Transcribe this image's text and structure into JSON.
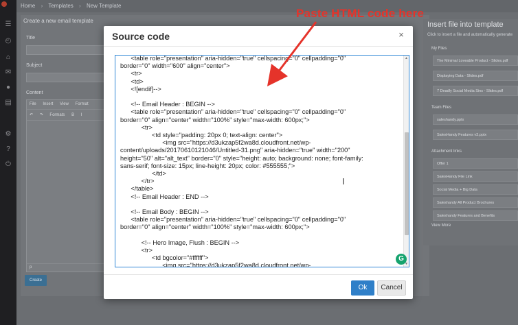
{
  "background": {
    "breadcrumb": [
      "Home",
      "Templates",
      "New Template"
    ],
    "card_title": "Create a new email template",
    "fields": {
      "title_label": "Title",
      "subject_label": "Subject",
      "content_label": "Content"
    },
    "editor": {
      "menus": [
        "File",
        "Insert",
        "View",
        "Format"
      ],
      "toolbar": [
        "↶",
        "↷",
        "Formats",
        "B",
        "I"
      ],
      "status_path": "p"
    },
    "create_button": "Create",
    "right_panel": {
      "title": "Insert file into template",
      "subtitle": "Click to insert a file and automatically generate",
      "sections": {
        "my_files": "My Files",
        "team_files": "Team Files",
        "attachment_links": "Attachment links"
      },
      "my_files": [
        "The Minimal Loveable Product - Slides.pdf",
        "Displaying Data - Slides.pdf",
        "7 Deadly Social Media Sins - Slides.pdf"
      ],
      "team_files": [
        "saleshandy.pptx",
        "SalesHandy Features v3.pptx"
      ],
      "attachment_links": [
        "Offer 1",
        "SalesHandy File Link",
        "Social Media + Big Data",
        "Saleshandy All Product Brochures",
        "Saleshandy Features and Benefits"
      ],
      "view_more": "View More"
    }
  },
  "modal": {
    "title": "Source code",
    "close_glyph": "×",
    "code": "      <table role=\"presentation\" aria-hidden=\"true\" cellspacing=\"0\" cellpadding=\"0\"\nborder=\"0\" width=\"600\" align=\"center\">\n      <tr>\n      <td>\n      <![endif]-->\n\n      <!-- Email Header : BEGIN -->\n      <table role=\"presentation\" aria-hidden=\"true\" cellspacing=\"0\" cellpadding=\"0\"\nborder=\"0\" align=\"center\" width=\"100%\" style=\"max-width: 600px;\">\n            <tr>\n                  <td style=\"padding: 20px 0; text-align: center\">\n                        <img src=\"https://d3ukzap5f2wa8d.cloudfront.net/wp-\ncontent/uploads/20170610121046/Untitled-31.png\" aria-hidden=\"true\" width=\"200\"\nheight=\"50\" alt=\"alt_text\" border=\"0\" style=\"height: auto; background: none; font-family:\nsans-serif; font-size: 15px; line-height: 20px; color: #555555;\">\n                  </td>\n            </tr>\n      </table>\n      <!-- Email Header : END -->\n\n      <!-- Email Body : BEGIN -->\n      <table role=\"presentation\" aria-hidden=\"true\" cellspacing=\"0\" cellpadding=\"0\"\nborder=\"0\" align=\"center\" width=\"100%\" style=\"max-width: 600px;\">\n\n            <!-- Hero Image, Flush : BEGIN -->\n            <tr>\n                  <td bgcolor=\"#ffffff\">\n                        <img src=\"https://d3ukzap5f2wa8d.cloudfront.net/wp-",
    "ok_label": "Ok",
    "cancel_label": "Cancel",
    "grammarly_glyph": "G",
    "text_cursor_glyph": "I"
  },
  "annotation": {
    "text": "Paste HTML code here",
    "color": "#e5332a"
  },
  "colors": {
    "accent_blue": "#2f7fc8",
    "focus_border": "#2f86d6",
    "grammarly_green": "#15a36e"
  }
}
